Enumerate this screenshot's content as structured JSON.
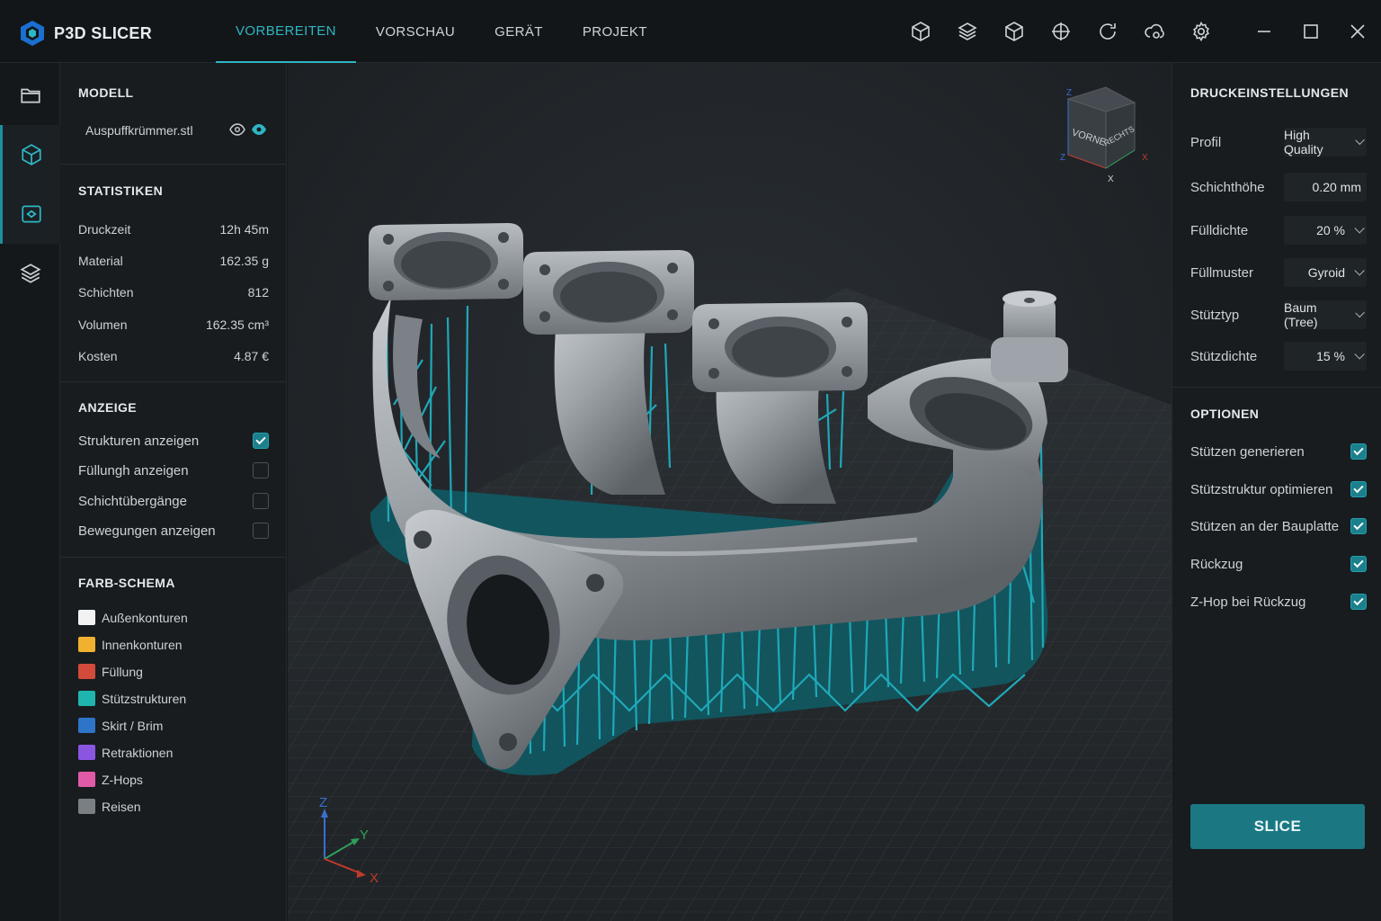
{
  "app": {
    "name": "P3D SLICER"
  },
  "tabs": [
    {
      "label": "VORBEREITEN",
      "active": true
    },
    {
      "label": "VORSCHAU"
    },
    {
      "label": "GERÄT"
    },
    {
      "label": "PROJEKT"
    }
  ],
  "toolbar_icons": [
    "cube-icon",
    "layers-icon",
    "box-icon",
    "crosshair-icon",
    "refresh-icon",
    "cloud-sync-icon",
    "gear-icon",
    "minimize-icon",
    "maximize-icon",
    "close-icon"
  ],
  "rail_icons": [
    "folder-icon",
    "cube-icon",
    "model-view-icon",
    "layers-icon"
  ],
  "left": {
    "model_title": "MODELL",
    "file_name": "Auspuffkrümmer.stl",
    "stats_title": "STATISTIKEN",
    "stats": [
      {
        "label": "Druckzeit",
        "value": "12h 45m"
      },
      {
        "label": "Material",
        "value": "162.35 g"
      },
      {
        "label": "Schichten",
        "value": "812"
      },
      {
        "label": "Volumen",
        "value": "162.35 cm³"
      },
      {
        "label": "Kosten",
        "value": "4.87 €"
      }
    ],
    "display_title": "ANZEIGE",
    "display": [
      {
        "label": "Strukturen anzeigen",
        "checked": true
      },
      {
        "label": "Füllungh anzeigen",
        "checked": false
      },
      {
        "label": "Schichtübergänge",
        "checked": false
      },
      {
        "label": "Bewegungen anzeigen",
        "checked": false
      }
    ],
    "scheme_title": "FARB-SCHEMA",
    "scheme": [
      {
        "label": "Außenkonturen",
        "color": "#f2f2f2"
      },
      {
        "label": "Innenkonturen",
        "color": "#f0b030"
      },
      {
        "label": "Füllung",
        "color": "#d24a3a"
      },
      {
        "label": "Stützstrukturen",
        "color": "#1fb5ae"
      },
      {
        "label": "Skirt / Brim",
        "color": "#2e74c9"
      },
      {
        "label": "Retraktionen",
        "color": "#8a55e0"
      },
      {
        "label": "Z-Hops",
        "color": "#e05aa8"
      },
      {
        "label": "Reisen",
        "color": "#7a7f84"
      }
    ]
  },
  "viewcube": {
    "front": "VORNE",
    "right": "RECHTS",
    "axes": [
      "Z",
      "Z",
      "X",
      "X"
    ]
  },
  "axis_gizmo": {
    "z": "Z",
    "y": "Y",
    "x": "X"
  },
  "right": {
    "print_title": "DRUCKEINSTELLUNGEN",
    "settings": [
      {
        "label": "Profil",
        "value": "High Quality",
        "type": "select"
      },
      {
        "label": "Schichthöhe",
        "value": "0.20 mm",
        "type": "input"
      },
      {
        "label": "Fülldichte",
        "value": "20 %",
        "type": "select"
      },
      {
        "label": "Füllmuster",
        "value": "Gyroid",
        "type": "select"
      },
      {
        "label": "Stütztyp",
        "value": "Baum (Tree)",
        "type": "select"
      },
      {
        "label": "Stützdichte",
        "value": "15 %",
        "type": "select"
      }
    ],
    "options_title": "OPTIONEN",
    "options": [
      {
        "label": "Stützen generieren",
        "checked": true
      },
      {
        "label": "Stützstruktur optimieren",
        "checked": true
      },
      {
        "label": "Stützen an der Bauplatte",
        "checked": true
      },
      {
        "label": "Rückzug",
        "checked": true
      },
      {
        "label": "Z-Hop bei Rückzug",
        "checked": true
      }
    ],
    "slice_label": "SLICE"
  },
  "colors": {
    "accent": "#2fb6c4",
    "support": "#1fa8b8",
    "model": "#9aa0a5"
  }
}
